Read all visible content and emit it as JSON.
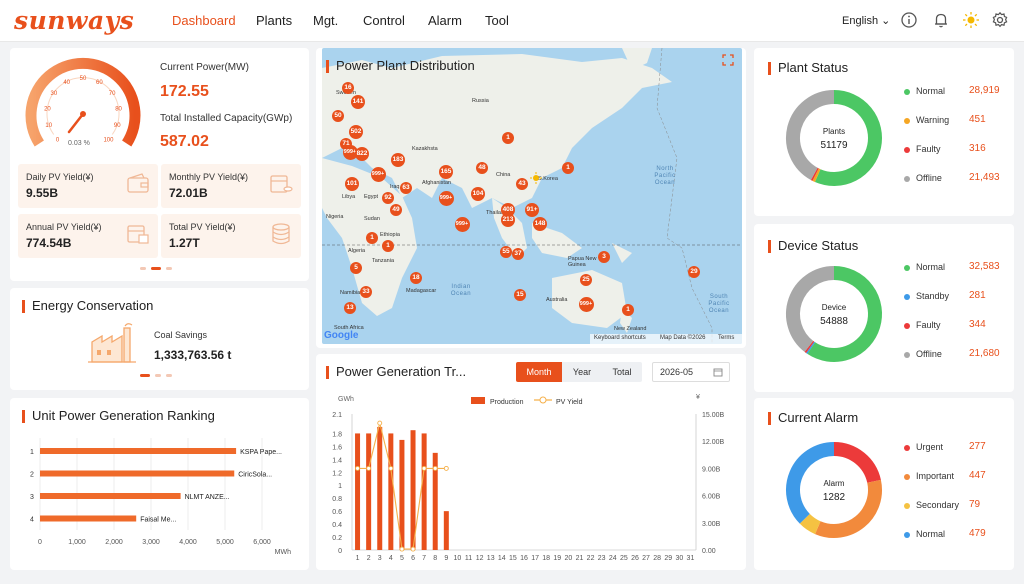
{
  "brand": {
    "logo": "sunways",
    "accent": "#e8501c"
  },
  "nav": {
    "items": [
      "Dashboard",
      "Plants",
      "Mgt.",
      "Control",
      "Alarm",
      "Tool"
    ],
    "active": "Dashboard"
  },
  "header": {
    "language": "English"
  },
  "overview": {
    "current_power_label": "Current Power(MW)",
    "current_power": "172.55",
    "capacity_label": "Total Installed Capacity(GWp)",
    "capacity": "587.02",
    "gauge_ticks": [
      "0",
      "10",
      "20",
      "30",
      "40",
      "50",
      "60",
      "70",
      "80",
      "90",
      "100"
    ],
    "gauge_value": "0.03 %",
    "gauge_fraction": 0.0003,
    "daily_label": "Daily PV Yield(¥)",
    "daily": "9.55B",
    "monthly_label": "Monthly PV Yield(¥)",
    "monthly": "72.01B",
    "annual_label": "Annual PV Yield(¥)",
    "annual": "774.54B",
    "total_label": "Total PV Yield(¥)",
    "total": "1.27T"
  },
  "energy": {
    "title": "Energy Conservation",
    "coal_label": "Coal Savings",
    "coal_value": "1,333,763.56 t"
  },
  "ranking": {
    "title": "Unit Power Generation Ranking",
    "unit": "MWh",
    "ticks": [
      "0",
      "1,000",
      "2,000",
      "3,000",
      "4,000",
      "5,000",
      "6,000"
    ],
    "rows": [
      {
        "rank": "1",
        "name": "KSPA Pape...",
        "value": 5300
      },
      {
        "rank": "2",
        "name": "CiricSola...",
        "value": 5250
      },
      {
        "rank": "3",
        "name": "NLMT ANZE...",
        "value": 3800
      },
      {
        "rank": "4",
        "name": "Faisal Me...",
        "value": 2600
      }
    ]
  },
  "map": {
    "title": "Power Plant Distribution",
    "labels": {
      "russia": "Russia",
      "sweden": "Sweden",
      "kazakhstan": "Kazakhsta",
      "china": "China",
      "skorea": "S.Korea",
      "afghanistan": "Afghanistan",
      "libya": "Libya",
      "egypt": "Egypt",
      "iraq": "Iraq",
      "sudan": "Sudan",
      "nigeria": "Nigeria",
      "ethiopia": "Ethiopia",
      "thailand": "Thailand",
      "algeria": "Algeria",
      "tanzania": "Tanzania",
      "namibia": "Namibia",
      "madagascar": "Madagascar",
      "australia": "Australia",
      "png": "Papua New Guinea",
      "nz": "New Zealand",
      "southafrica": "South Africa",
      "indian": "Indian Ocean",
      "northpac": "North Pacific Ocean",
      "southpac": "South Pacific Ocean"
    },
    "markers": [
      "16",
      "141",
      "50",
      "502",
      "71",
      "999+",
      "822",
      "183",
      "63",
      "165",
      "48",
      "43",
      "1",
      "1",
      "999+",
      "101",
      "92",
      "104",
      "999+",
      "408",
      "213",
      "91+",
      "148",
      "999+",
      "49",
      "1",
      "1",
      "5",
      "18",
      "55",
      "37",
      "3",
      "25",
      "29",
      "33",
      "13",
      "15",
      "999+",
      "1"
    ],
    "footer": {
      "shortcuts": "Keyboard shortcuts",
      "mapdata": "Map Data ©2026",
      "terms": "Terms",
      "google": "Google"
    }
  },
  "trend": {
    "title": "Power Generation Tr...",
    "tabs": [
      "Month",
      "Year",
      "Total"
    ],
    "active_tab": "Month",
    "date": "2026-05",
    "legend": {
      "production": "Production",
      "yield": "PV Yield"
    },
    "left_unit": "GWh",
    "right_unit": "¥"
  },
  "chart_data": {
    "type": "bar",
    "title": "Power Generation Tr...",
    "categories": [
      "1",
      "2",
      "3",
      "4",
      "5",
      "6",
      "7",
      "8",
      "9",
      "10",
      "11",
      "12",
      "13",
      "14",
      "15",
      "16",
      "17",
      "18",
      "19",
      "20",
      "21",
      "22",
      "23",
      "24",
      "25",
      "26",
      "27",
      "28",
      "29",
      "30",
      "31"
    ],
    "series": [
      {
        "name": "Production",
        "axis": "left",
        "values": [
          1.8,
          1.8,
          1.9,
          1.8,
          1.7,
          1.85,
          1.8,
          1.5,
          0.6,
          0,
          0,
          0,
          0,
          0,
          0,
          0,
          0,
          0,
          0,
          0,
          0,
          0,
          0,
          0,
          0,
          0,
          0,
          0,
          0,
          0,
          0
        ]
      },
      {
        "name": "PV Yield",
        "axis": "right",
        "values": [
          9.0,
          9.0,
          14.0,
          9.0,
          0.1,
          0.1,
          9.0,
          9.0,
          9.0
        ]
      }
    ],
    "ylim": [
      0,
      2.1
    ],
    "y2lim": [
      0,
      15
    ],
    "yticks": [
      "0",
      "0.2",
      "0.4",
      "0.6",
      "0.8",
      "1",
      "1.2",
      "1.4",
      "1.6",
      "1.8",
      "2.1"
    ],
    "y2ticks": [
      "0.00",
      "3.00B",
      "6.00B",
      "9.00B",
      "12.00B",
      "15.00B"
    ]
  },
  "plant_status": {
    "title": "Plant Status",
    "center_label": "Plants",
    "center_value": "51179",
    "items": [
      {
        "label": "Normal",
        "value": "28,919",
        "color": "#4cc764",
        "n": 28919
      },
      {
        "label": "Warning",
        "value": "451",
        "color": "#f5a623",
        "n": 451
      },
      {
        "label": "Faulty",
        "value": "316",
        "color": "#ec3a3a",
        "n": 316
      },
      {
        "label": "Offline",
        "value": "21,493",
        "color": "#a8a8a8",
        "n": 21493
      }
    ]
  },
  "device_status": {
    "title": "Device Status",
    "center_label": "Device",
    "center_value": "54888",
    "items": [
      {
        "label": "Normal",
        "value": "32,583",
        "color": "#4cc764",
        "n": 32583
      },
      {
        "label": "Standby",
        "value": "281",
        "color": "#3e9ae8",
        "n": 281
      },
      {
        "label": "Faulty",
        "value": "344",
        "color": "#ec3a3a",
        "n": 344
      },
      {
        "label": "Offline",
        "value": "21,680",
        "color": "#a8a8a8",
        "n": 21680
      }
    ]
  },
  "alarm": {
    "title": "Current Alarm",
    "center_label": "Alarm",
    "center_value": "1282",
    "items": [
      {
        "label": "Urgent",
        "value": "277",
        "color": "#ec3a3a",
        "n": 277
      },
      {
        "label": "Important",
        "value": "447",
        "color": "#f28a3c",
        "n": 447
      },
      {
        "label": "Secondary",
        "value": "79",
        "color": "#f5c242",
        "n": 79
      },
      {
        "label": "Normal",
        "value": "479",
        "color": "#3e9ae8",
        "n": 479
      }
    ]
  }
}
